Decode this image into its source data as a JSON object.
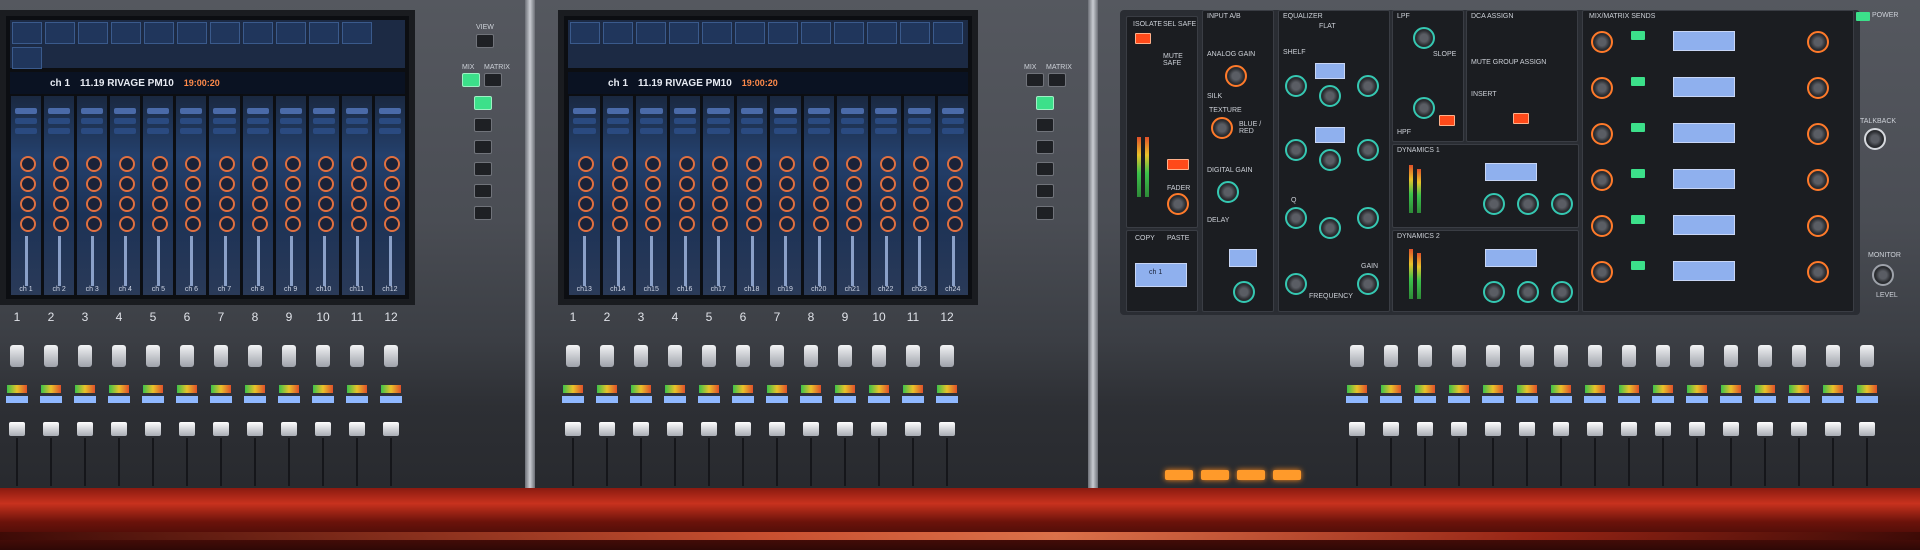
{
  "screens": [
    {
      "title": "11.19 RIVAGE PM10",
      "time": "19:00:20",
      "left_label": "ch 1",
      "channel_names": [
        "ch 1",
        "ch 2",
        "ch 3",
        "ch 4",
        "ch 5",
        "ch 6",
        "ch 7",
        "ch 8",
        "ch 9",
        "ch10",
        "ch11",
        "ch12"
      ]
    },
    {
      "title": "11.19 RIVAGE PM10",
      "time": "19:00:20",
      "left_label": "ch 1",
      "channel_names": [
        "ch13",
        "ch14",
        "ch15",
        "ch16",
        "ch17",
        "ch18",
        "ch19",
        "ch20",
        "ch21",
        "ch22",
        "ch23",
        "ch24"
      ]
    }
  ],
  "channel_numbers": [
    "1",
    "2",
    "3",
    "4",
    "5",
    "6",
    "7",
    "8",
    "9",
    "10",
    "11",
    "12"
  ],
  "bay_labels": {
    "view": "VIEW",
    "mix": "MIX",
    "matrix": "MATRIX"
  },
  "selected_channel_panel": {
    "isolate": "ISOLATE",
    "sel_safe": "SEL SAFE",
    "mute_safe": "MUTE SAFE",
    "input_ab": "INPUT A/B",
    "analog_gain": "ANALOG GAIN",
    "silk": "SILK",
    "texture": "TEXTURE",
    "blue_red": "BLUE / RED",
    "digital_gain": "DIGITAL GAIN",
    "delay": "DELAY",
    "equalizer": "EQUALIZER",
    "flat": "FLAT",
    "shelf": "SHELF",
    "q": "Q",
    "frequency": "FREQUENCY",
    "gain": "GAIN",
    "lpf": "LPF",
    "hpf": "HPF",
    "slope": "SLOPE",
    "dca_assign": "DCA ASSIGN",
    "mute_group_assign": "MUTE GROUP ASSIGN",
    "insert": "INSERT",
    "dynamics1": "DYNAMICS 1",
    "dynamics2": "DYNAMICS 2",
    "mix_matrix_sends": "MIX/MATRIX SENDS",
    "copy": "COPY",
    "paste": "PASTE",
    "on": "ON",
    "fader": "FADER",
    "ch_display": "ch 1"
  },
  "right_labels": {
    "power": "POWER",
    "talkback": "TALKBACK",
    "monitor": "MONITOR",
    "level": "LEVEL"
  }
}
